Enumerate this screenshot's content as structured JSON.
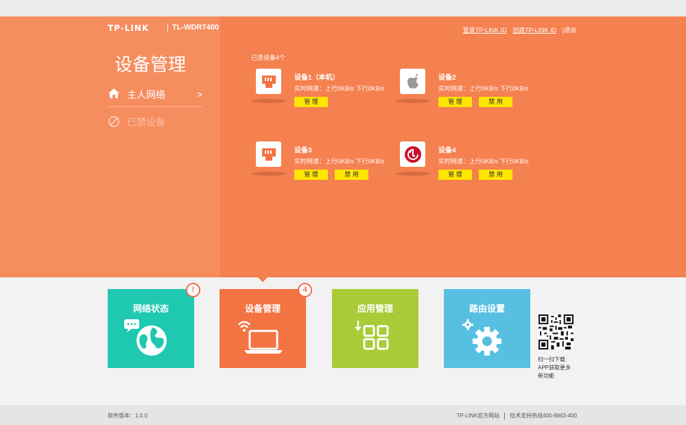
{
  "header": {
    "brand": "TP-LINK",
    "model": "TL-WDR7400",
    "links": [
      "登录TP-LINK ID",
      "创建TP-LINK ID",
      "|退出"
    ]
  },
  "sidebar": {
    "title": "设备管理",
    "items": [
      {
        "label": "主人网络",
        "arrow": ">"
      },
      {
        "label": "已禁设备"
      }
    ]
  },
  "main": {
    "connected_label": "已连设备4个",
    "devices": [
      {
        "name": "设备1（本机）",
        "speed": "实时网速：上行0KB/s  下行0KB/s",
        "icon": "ethernet-icon",
        "buttons": [
          "管 理"
        ]
      },
      {
        "name": "设备2",
        "speed": "实时网速：上行0KB/s  下行0KB/s",
        "icon": "apple-icon",
        "buttons": [
          "管 理",
          "禁 用"
        ]
      },
      {
        "name": "设备3",
        "speed": "实时网速：上行0KB/s  下行0KB/s",
        "icon": "ethernet-icon",
        "buttons": [
          "管 理",
          "禁 用"
        ]
      },
      {
        "name": "设备4",
        "speed": "实时网速：上行0KB/s  下行0KB/s",
        "icon": "lg-icon",
        "buttons": [
          "管 理",
          "禁 用"
        ]
      }
    ]
  },
  "tiles": [
    {
      "label": "网络状态",
      "color": "#1fc8b1",
      "badge": "!",
      "icon": "globe-icon"
    },
    {
      "label": "设备管理",
      "color": "#f47343",
      "badge": "4",
      "icon": "laptop-icon"
    },
    {
      "label": "应用管理",
      "color": "#a9cb37",
      "icon": "apps-icon"
    },
    {
      "label": "路由设置",
      "color": "#57c0e2",
      "icon": "gear-icon"
    }
  ],
  "qr": {
    "lines": [
      "扫一扫下载",
      "APP获取更多",
      "新功能"
    ]
  },
  "footer": {
    "version": "软件版本：1.0.0",
    "site": "TP-LINK官方网站",
    "support": "技术支持热线400-8863-400"
  },
  "colors": {
    "orange": "#f58050",
    "sidebar": "#f68d5f",
    "button": "#ffe500"
  }
}
